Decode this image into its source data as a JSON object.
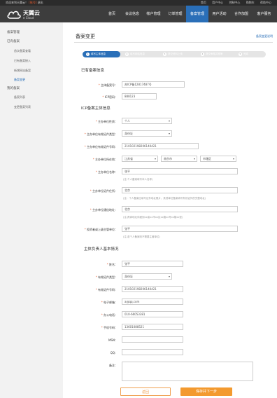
{
  "topbar": {
    "welcome_prefix": "欢迎来到天翼云！",
    "username": "[账号]",
    "logout": "退出",
    "links": [
      "首页",
      "用户中心",
      "控制中心",
      "购物车",
      "帮助中心"
    ]
  },
  "logo": {
    "name": "天翼云",
    "sub": "e Cloud"
  },
  "nav": [
    "首页",
    "会议信息",
    "帐户管理",
    "订单管理",
    "备案管理",
    "用户活动",
    "合作加盟",
    "客户服务"
  ],
  "sidebar": {
    "group1": "备案管理",
    "group1b": "已有备案",
    "group1_items": [
      "首次备案查看",
      "已有备案接入",
      "新增网站备案",
      "备案变更"
    ],
    "group2": "我的备案",
    "group2_items": [
      "备案列表",
      "变更备案列表"
    ]
  },
  "page": {
    "title": "备案变更",
    "help_link": "备案变更说明",
    "steps": [
      "填写主体信息",
      "填写网站信息",
      "提交资料上传",
      "提交审核并预审",
      "完成"
    ]
  },
  "existing": {
    "section": "已有备案信息",
    "entity_no_label": "主体备案号：",
    "entity_no": "苏ICP备12817487号",
    "icp_pwd_label": "ICP密码：",
    "icp_pwd": "888123"
  },
  "entity": {
    "section": "ICP备案主体信息",
    "nature_label": "主办单位性质：",
    "nature": "个人",
    "cert_type_label": "主办单位有效证件类型：",
    "cert_type": "身份证",
    "cert_no_label": "主办单位有效证件号码：",
    "cert_no": "210102198206140421",
    "region_label": "主办单位所在地：",
    "province": "江苏省",
    "city": "南京市",
    "district": "市辖区",
    "unit_name_label": "主办单位名称：",
    "unit_name": "张平",
    "unit_name_hint": "(注:个人备案填写本人名称)",
    "cert_addr_label": "主办单位证件住所：",
    "cert_addr": "北京",
    "cert_addr_hint": "(注：个人备案应填写证件地址照片，其他单位备案填写有效证件的完整地址)",
    "comm_addr_label": "主办单位通信地址：",
    "comm_addr": "北京",
    "comm_addr_hint": "(注:具体地址详细到xx省xx市xx区xx路xx号xx楼xx室)",
    "investor_label": "投资者或上级主管单位：",
    "investor": "张平",
    "investor_hint": "(注:若个人备案则不需要主管单位)"
  },
  "person": {
    "section": "主体负责人基本情况",
    "name_label": "姓名：",
    "name": "张平",
    "cert_type_label": "有效证件类型：",
    "cert_type": "身份证",
    "cert_no_label": "有效证件号码：",
    "cert_no": "210102198206140421",
    "email_label": "电子邮箱：",
    "email": "a@qq.com",
    "office_label": "办公电话：",
    "office": "010-66053381",
    "mobile_label": "手机号码：",
    "mobile": "13601088521",
    "msn_label": "MSN：",
    "qq_label": "QQ：",
    "remark_label": "备注："
  },
  "buttons": {
    "back": "返回",
    "next": "保存并下一步"
  }
}
